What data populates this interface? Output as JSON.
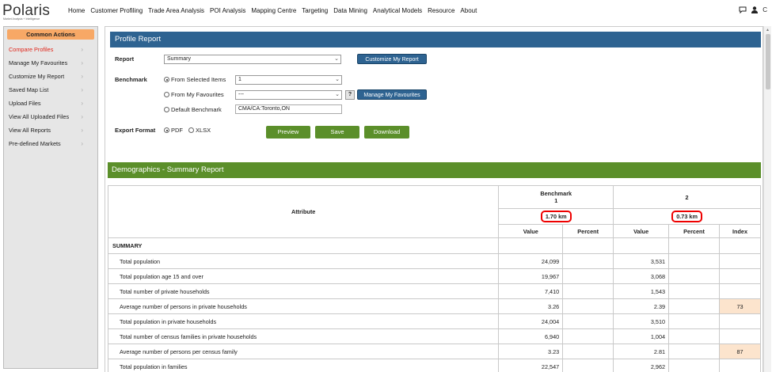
{
  "app": {
    "logo_text": "Polaris",
    "logo_tagline": "Market Analysis + Intelligence"
  },
  "nav": {
    "items": [
      "Home",
      "Customer Profiling",
      "Trade Area Analysis",
      "POI Analysis",
      "Mapping Centre",
      "Targeting",
      "Data Mining",
      "Analytical Models",
      "Resource",
      "About"
    ]
  },
  "top_right": {
    "chat_icon": "chat-bubble-icon",
    "user_icon": "user-icon",
    "user_label": "C"
  },
  "sidebar": {
    "header": "Common Actions",
    "items": [
      {
        "label": "Compare Profiles",
        "active": true
      },
      {
        "label": "Manage My Favourites"
      },
      {
        "label": "Customize My Report"
      },
      {
        "label": "Saved Map List"
      },
      {
        "label": "Upload Files"
      },
      {
        "label": "View All Uploaded Files"
      },
      {
        "label": "View All Reports"
      },
      {
        "label": "Pre-defined Markets"
      }
    ]
  },
  "profile_report": {
    "title": "Profile Report",
    "report_label": "Report",
    "report_value": "Summary",
    "customize_button": "Customize My Report",
    "benchmark_label": "Benchmark",
    "from_selected_label": "From Selected Items",
    "from_selected_value": "1",
    "from_favourites_label": "From My Favourites",
    "from_favourites_value": "---",
    "help_button": "?",
    "manage_favourites_button": "Manage My Favourites",
    "default_benchmark_label": "Default Benchmark",
    "default_benchmark_value": "CMA/CA:Toronto,ON",
    "export_label": "Export Format",
    "pdf_label": "PDF",
    "xlsx_label": "XLSX",
    "preview_button": "Preview",
    "save_button": "Save",
    "download_button": "Download"
  },
  "summary": {
    "title": "Demographics - Summary Report",
    "attribute_header": "Attribute",
    "benchmark_header": "Benchmark",
    "benchmark_sub": "1",
    "col2_header": "2",
    "benchmark_radius": "1.70 km",
    "col2_radius": "0.73 km",
    "value_header": "Value",
    "percent_header": "Percent",
    "index_header": "Index",
    "section": "SUMMARY",
    "rows": [
      {
        "attr": "Total population",
        "bv": "24,099",
        "v2": "3,531",
        "idx": ""
      },
      {
        "attr": "Total population age 15 and over",
        "bv": "19,967",
        "v2": "3,068",
        "idx": ""
      },
      {
        "attr": "Total number of private households",
        "bv": "7,410",
        "v2": "1,543",
        "idx": ""
      },
      {
        "attr": "Average number of persons in private households",
        "bv": "3.26",
        "v2": "2.39",
        "idx": "73"
      },
      {
        "attr": "Total population in private households",
        "bv": "24,004",
        "v2": "3,510",
        "idx": ""
      },
      {
        "attr": "Total number of census families in private households",
        "bv": "6,940",
        "v2": "1,004",
        "idx": ""
      },
      {
        "attr": "Average number of persons per census family",
        "bv": "3.23",
        "v2": "2.81",
        "idx": "87"
      },
      {
        "attr": "Total population in families",
        "bv": "22,547",
        "v2": "2,962",
        "idx": ""
      }
    ]
  }
}
